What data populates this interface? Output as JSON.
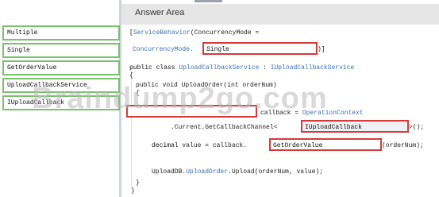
{
  "header": {
    "title": "Answer Area"
  },
  "options": [
    {
      "label": "Multiple"
    },
    {
      "label": "Single"
    },
    {
      "label": "GetOrderValue"
    },
    {
      "label": "UploadCallbackService"
    },
    {
      "label": "IUploadCallback"
    }
  ],
  "code": {
    "l1_attr": "ServiceBehavior",
    "l1_rest": "(ConcurrencyMode =",
    "l2_prefix": "ConcurrencyMode.",
    "l2_suffix": ")]",
    "l3_kw": "public class",
    "l3_type": "UploadCallbackService",
    "l3_sep": ":",
    "l3_iface": "IUploadCallbackService",
    "l4": "{",
    "l5": "public void UploadOrder(int orderNum)",
    "l6": "{",
    "l7_rest": "callback =",
    "l7_type": "OperationContext",
    "l8": ".Current.GetCallbackChannel<",
    "l8_suffix": ">();",
    "l9_kw": "decimal",
    "l9_mid": "value = callback.",
    "l9_suffix": "(orderNum);",
    "l10_prefix": "UploadDB.",
    "l10_method": "UploadOrder",
    "l10_suffix": ".Upload(orderNum, value);",
    "l11": "}",
    "l12": "}"
  },
  "slots": {
    "slot1": "Single",
    "slot2": "",
    "slot3": "IUploadCallback",
    "slot4": "GetOrderValue"
  },
  "watermark": "Braindump2go.com"
}
